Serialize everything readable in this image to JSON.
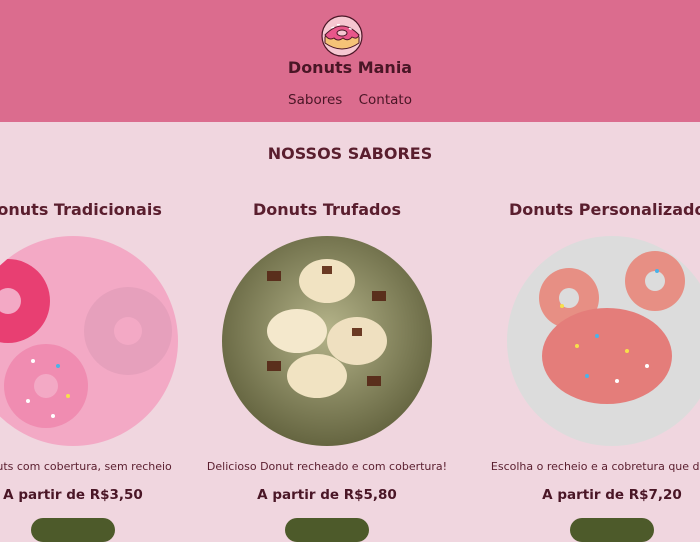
{
  "header": {
    "brand": "Donuts Mania",
    "logo_icon": "donut-icon",
    "nav": [
      {
        "label": "Sabores"
      },
      {
        "label": "Contato"
      }
    ]
  },
  "main": {
    "section_title": "NOSSOS SABORES",
    "cards": [
      {
        "title": "Donuts Tradicionais",
        "desc": "Donuts com cobertura, sem recheio",
        "price": "A partir de R$3,50",
        "image": "pink-frosted-donuts"
      },
      {
        "title": "Donuts Trufados",
        "desc": "Delicioso Donut recheado e com cobertura!",
        "price": "A partir de R$5,80",
        "image": "truffle-donuts-with-chocolate"
      },
      {
        "title": "Donuts Personalizados",
        "desc": "Escolha o recheio e a cobretura que desejar",
        "price": "A partir de R$7,20",
        "image": "mouse-shaped-sprinkle-donut"
      }
    ]
  },
  "colors": {
    "header_bg": "#db6c8e",
    "page_bg": "#f0d6df",
    "text": "#5a1e2e",
    "button": "#4d5a2a"
  }
}
